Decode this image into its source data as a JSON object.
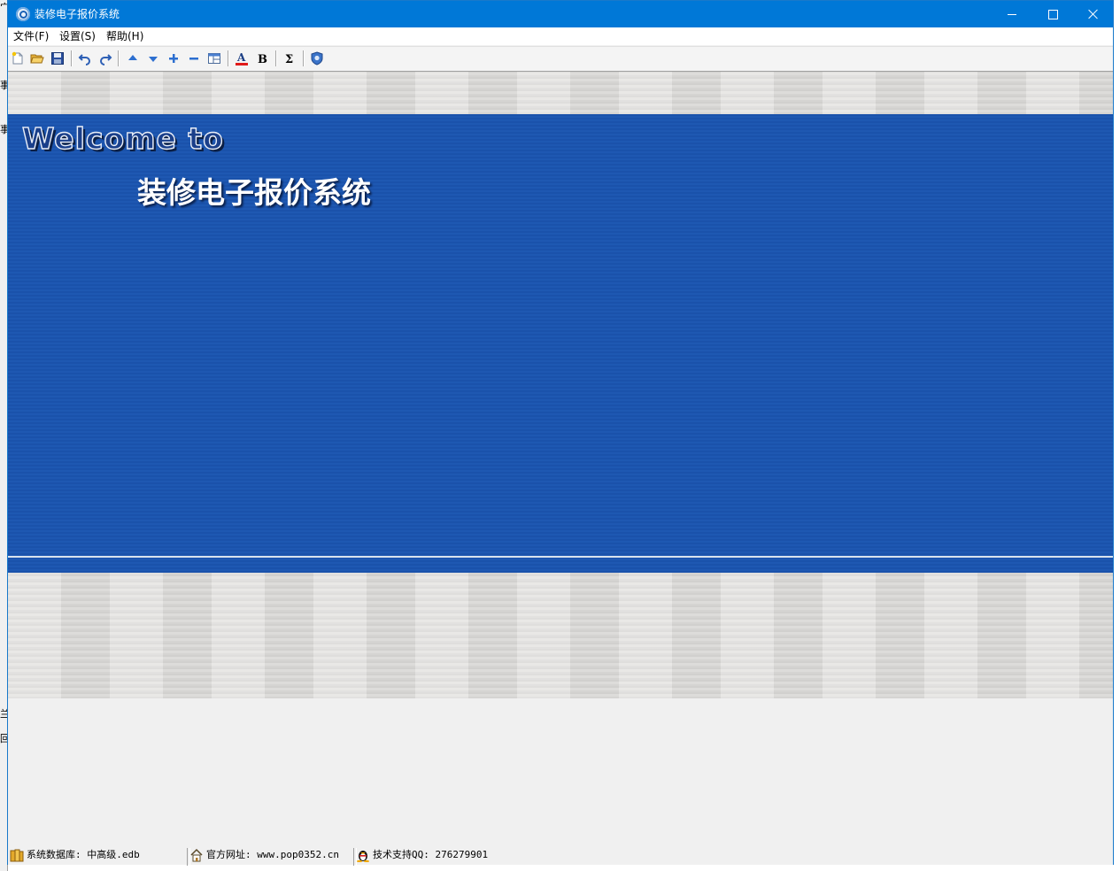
{
  "window": {
    "title": "装修电子报价系统"
  },
  "menu": [
    {
      "label": "文件(F)"
    },
    {
      "label": "设置(S)"
    },
    {
      "label": "帮助(H)"
    }
  ],
  "toolbar": {
    "groups": [
      [
        "new-file-icon",
        "open-folder-icon",
        "save-icon"
      ],
      [
        "undo-icon",
        "redo-icon"
      ],
      [
        "move-up-icon",
        "move-down-icon",
        "add-row-icon",
        "remove-row-icon",
        "layout-icon"
      ],
      [
        "font-color-icon",
        "bold-icon"
      ],
      [
        "sum-icon"
      ],
      [
        "shield-icon"
      ]
    ],
    "font_color_glyph": "A",
    "bold_glyph": "B",
    "sum_glyph": "Σ"
  },
  "banner": {
    "welcome": "Welcome to",
    "product_name": "装修电子报价系统"
  },
  "statusbar": {
    "database": "系统数据库: 中高级.edb",
    "website": "官方网址: www.pop0352.cn",
    "support": "技术支持QQ: 276279901"
  },
  "colors": {
    "titlebar": "#0078d7",
    "banner_blue": "#1c55ae",
    "stripe_gray": "#dddcda"
  },
  "background_window_fragments": [
    "宀",
    "事",
    "事",
    "兰",
    "回"
  ]
}
